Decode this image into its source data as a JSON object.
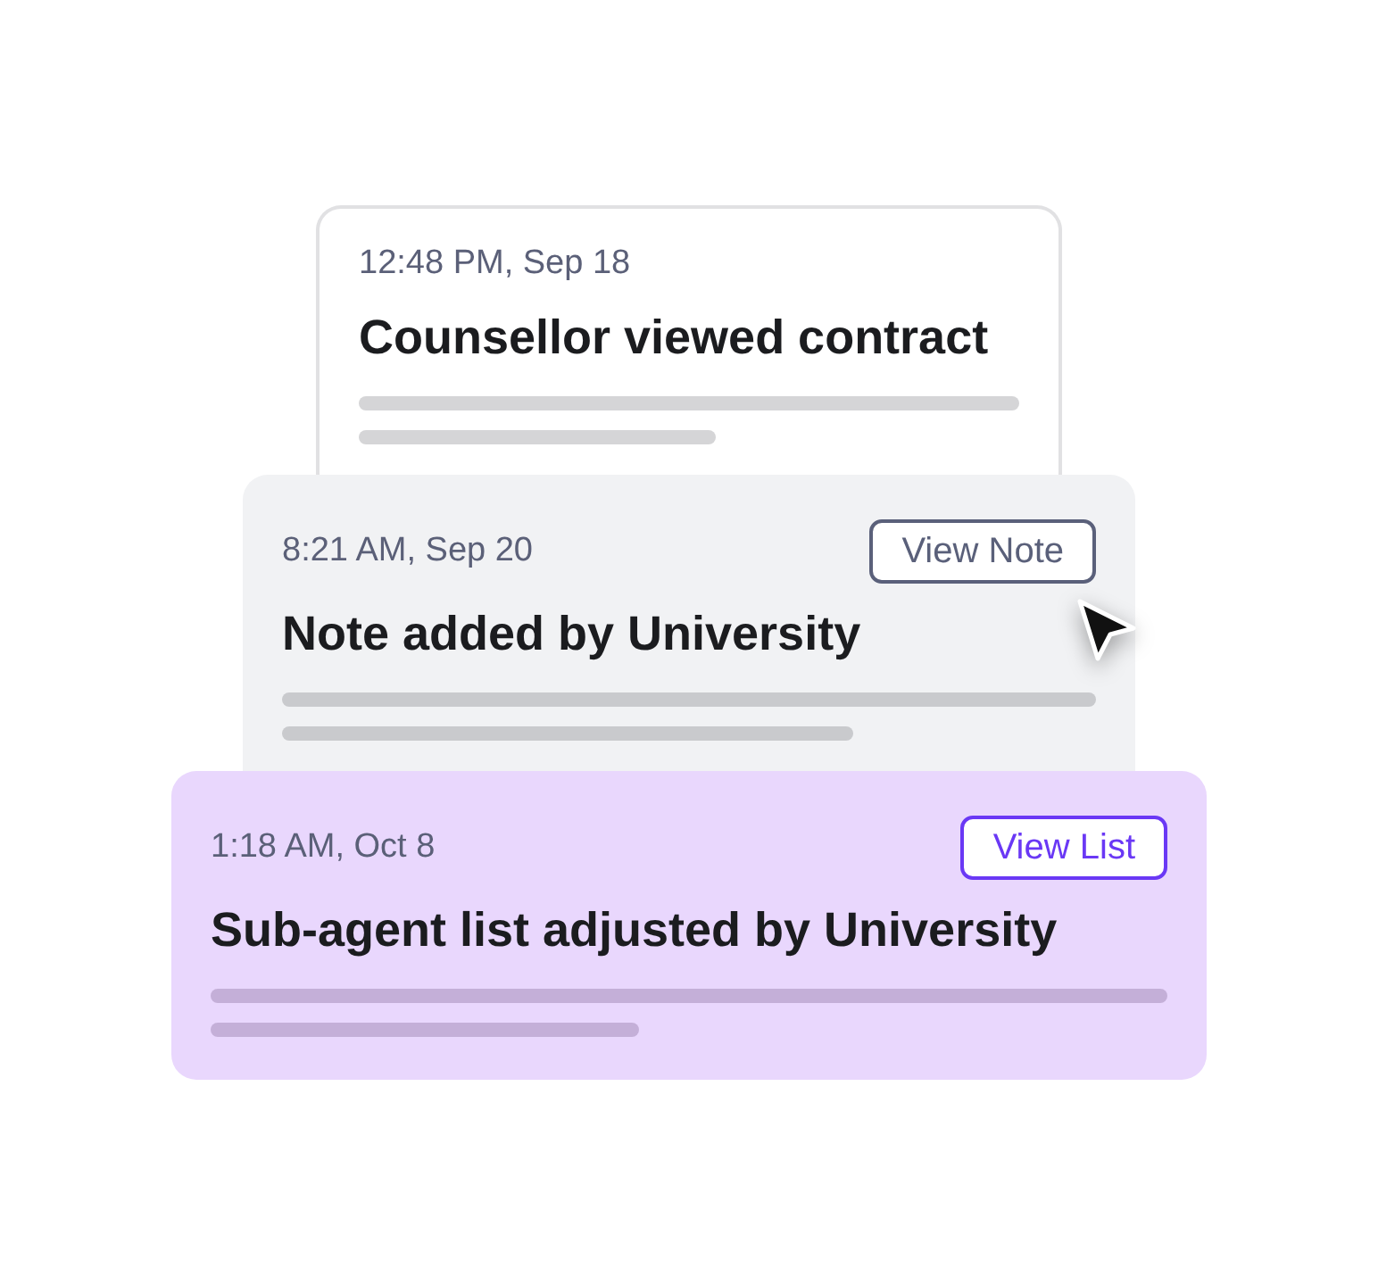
{
  "events": [
    {
      "kind": "outlined",
      "timestamp": "12:48 PM, Sep 18",
      "title": "Counsellor viewed contract"
    },
    {
      "kind": "muted",
      "timestamp": "8:21 AM, Sep 20",
      "title": "Note added by University",
      "button": {
        "label": "View Note",
        "hovered": true
      }
    },
    {
      "kind": "highlighted",
      "timestamp": "1:18 AM, Oct 8",
      "title": "Sub-agent list adjusted by University",
      "button": {
        "label": "View List"
      }
    }
  ]
}
